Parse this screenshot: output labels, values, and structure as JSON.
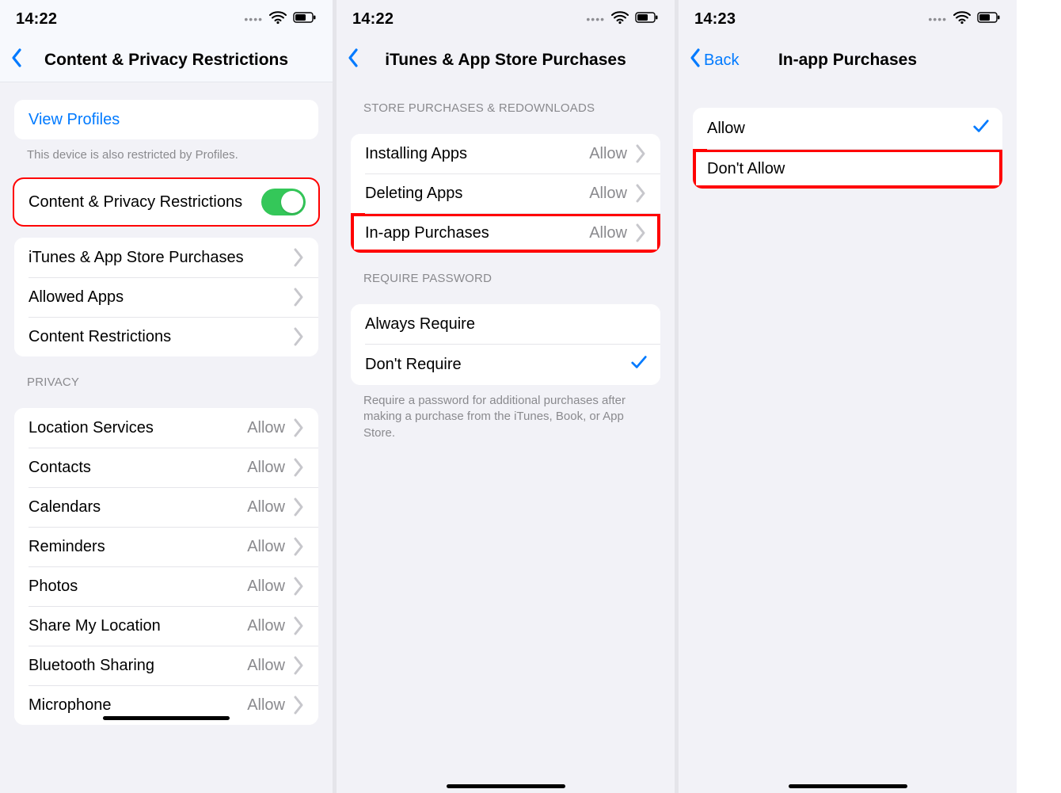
{
  "panel0": {
    "time": "14:22",
    "title": "Content & Privacy Restrictions",
    "view_profiles": "View Profiles",
    "profiles_footer": "This device is also restricted by Profiles.",
    "toggle_label": "Content & Privacy Restrictions",
    "menu": {
      "itunes": "iTunes & App Store Purchases",
      "allowed": "Allowed Apps",
      "content": "Content Restrictions"
    },
    "privacy_header": "Privacy",
    "privacy": [
      {
        "label": "Location Services",
        "value": "Allow"
      },
      {
        "label": "Contacts",
        "value": "Allow"
      },
      {
        "label": "Calendars",
        "value": "Allow"
      },
      {
        "label": "Reminders",
        "value": "Allow"
      },
      {
        "label": "Photos",
        "value": "Allow"
      },
      {
        "label": "Share My Location",
        "value": "Allow"
      },
      {
        "label": "Bluetooth Sharing",
        "value": "Allow"
      },
      {
        "label": "Microphone",
        "value": "Allow"
      }
    ]
  },
  "panel1": {
    "time": "14:22",
    "title": "iTunes & App Store Purchases",
    "store_header": "Store Purchases & Redownloads",
    "store": [
      {
        "label": "Installing Apps",
        "value": "Allow"
      },
      {
        "label": "Deleting Apps",
        "value": "Allow"
      },
      {
        "label": "In-app Purchases",
        "value": "Allow"
      }
    ],
    "password_header": "Require Password",
    "password": [
      {
        "label": "Always Require",
        "checked": false
      },
      {
        "label": "Don't Require",
        "checked": true
      }
    ],
    "password_footer": "Require a password for additional purchases after making a purchase from the iTunes, Book, or App Store."
  },
  "panel2": {
    "time": "14:23",
    "back": "Back",
    "title": "In-app Purchases",
    "options": [
      {
        "label": "Allow",
        "checked": true
      },
      {
        "label": "Don't Allow",
        "checked": false
      }
    ]
  }
}
